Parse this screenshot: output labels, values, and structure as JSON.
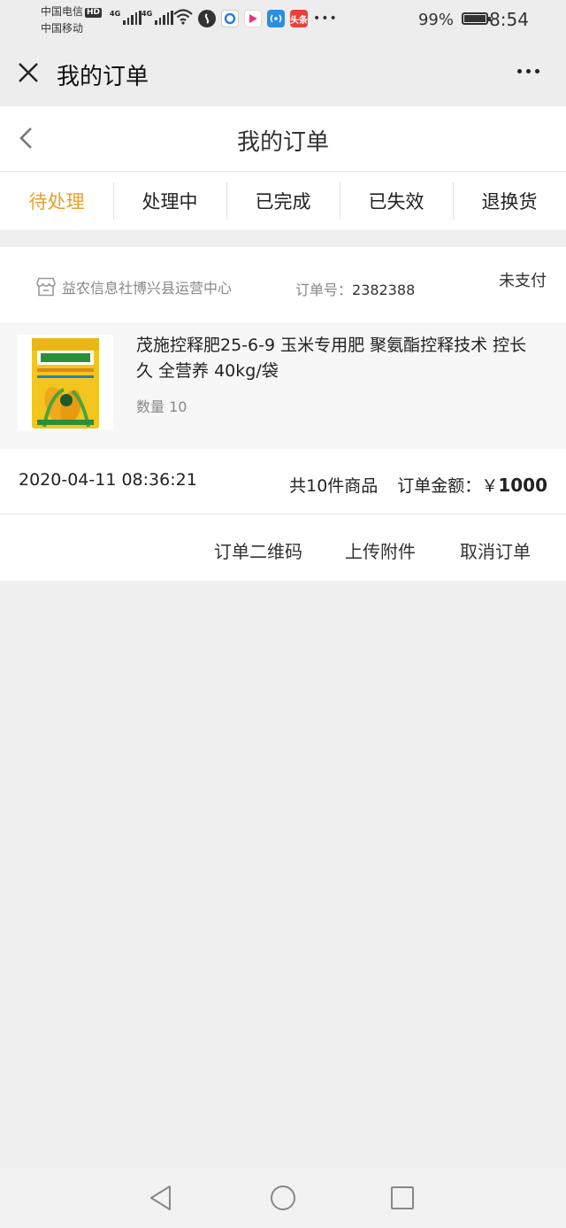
{
  "status_bar": {
    "carrier_1": "中国电信",
    "hd_badge": "HD",
    "carrier_2": "中国移动",
    "network_1": "4G",
    "network_2": "4G",
    "toutiao_label": "头条",
    "battery_percent": "99%",
    "battery_level": 0.99,
    "time": "8:54"
  },
  "title_bar": {
    "title": "我的订单"
  },
  "page": {
    "title": "我的订单"
  },
  "tabs": [
    {
      "label": "待处理",
      "active": true
    },
    {
      "label": "处理中",
      "active": false
    },
    {
      "label": "已完成",
      "active": false
    },
    {
      "label": "已失效",
      "active": false
    },
    {
      "label": "退换货",
      "active": false
    }
  ],
  "order": {
    "shop_name": "益农信息社博兴县运营中心",
    "order_no_label": "订单号：",
    "order_no": "2382388",
    "status": "未支付",
    "product": {
      "name": "茂施控释肥25-6-9 玉米专用肥 聚氨酯控释技术 控长久 全营养 40kg/袋",
      "quantity": "数量 10",
      "image_icon": "fertilizer-bag-image"
    },
    "time": "2020-04-11 08:36:21",
    "item_count": "共10件商品",
    "amount_label": "订单金额：",
    "amount_symbol": "￥",
    "amount": "1000",
    "actions": [
      "订单二维码",
      "上传附件",
      "取消订单"
    ]
  },
  "colors": {
    "accent": "#e8a12b",
    "background": "#efefef"
  }
}
